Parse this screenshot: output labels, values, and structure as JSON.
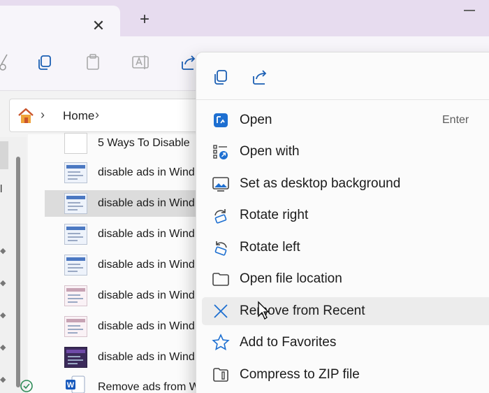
{
  "tabs": {
    "close_glyph": "✕",
    "new_glyph": "+"
  },
  "address": {
    "crumb": "Home",
    "separator": "›"
  },
  "nav": {
    "partial_text": "l"
  },
  "files": [
    {
      "name": "5 Ways To Disable",
      "thumb": "plain",
      "selected": false
    },
    {
      "name": "disable ads in Wind",
      "thumb": "blue",
      "selected": false
    },
    {
      "name": "disable ads in Wind",
      "thumb": "blue",
      "selected": true
    },
    {
      "name": "disable ads in Wind",
      "thumb": "blue",
      "selected": false
    },
    {
      "name": "disable ads in Wind",
      "thumb": "blue",
      "selected": false
    },
    {
      "name": "disable ads in Wind",
      "thumb": "pink",
      "selected": false
    },
    {
      "name": "disable ads in Wind",
      "thumb": "pink",
      "selected": false
    },
    {
      "name": "disable ads in Wind",
      "thumb": "dark",
      "selected": false
    },
    {
      "name": "Remove ads from W",
      "thumb": "word",
      "selected": false
    }
  ],
  "menu": {
    "quick_actions": [
      "copy-icon",
      "share-icon"
    ],
    "items": [
      {
        "label": "Open",
        "shortcut": "Enter",
        "icon": "photos-app-icon"
      },
      {
        "label": "Open with",
        "shortcut": "",
        "icon": "open-with-icon"
      },
      {
        "label": "Set as desktop background",
        "shortcut": "",
        "icon": "desktop-background-icon"
      },
      {
        "label": "Rotate right",
        "shortcut": "",
        "icon": "rotate-right-icon"
      },
      {
        "label": "Rotate left",
        "shortcut": "",
        "icon": "rotate-left-icon"
      },
      {
        "label": "Open file location",
        "shortcut": "",
        "icon": "folder-icon"
      },
      {
        "label": "Remove from Recent",
        "shortcut": "",
        "icon": "close-icon"
      },
      {
        "label": "Add to Favorites",
        "shortcut": "",
        "icon": "star-icon"
      },
      {
        "label": "Compress to ZIP file",
        "shortcut": "",
        "icon": "zip-icon"
      }
    ]
  },
  "colors": {
    "accent": "#0067c0",
    "tab_strip": "#e7dcef",
    "selected_row": "#dcdcdc"
  }
}
